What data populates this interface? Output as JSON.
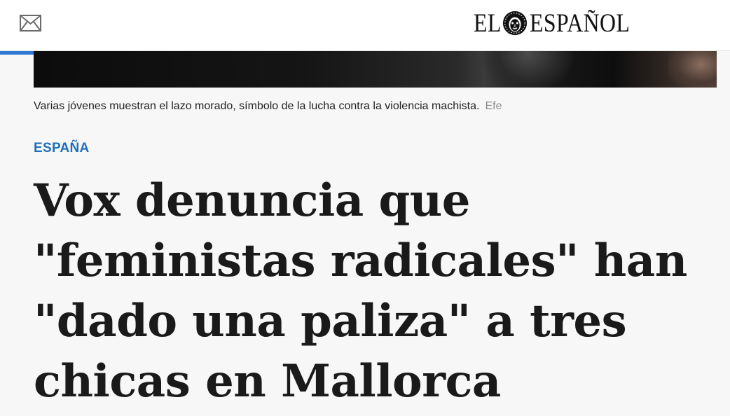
{
  "header": {
    "logo_text_left": "EL",
    "logo_text_right": "ESPAÑOL",
    "mail_icon": "envelope-icon",
    "logo_icon": "lion-head-icon"
  },
  "reading_progress": 0.302,
  "article": {
    "photo_caption": "Varias jóvenes muestran el lazo morado, símbolo de la lucha contra la violencia machista.",
    "photo_credit": "Efe",
    "section": "ESPAÑA",
    "headline": "Vox denuncia que \"feministas radicales\" han \"dado una paliza\" a tres chicas en Mallorca"
  },
  "colors": {
    "accent": "#1f6fb8",
    "progress": "#2d7ad3",
    "background": "#f7f7f7",
    "header_bg": "#ffffff"
  }
}
